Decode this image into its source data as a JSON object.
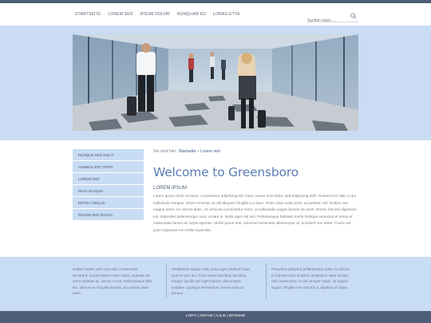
{
  "nav": {
    "items": [
      "Startseite",
      "Lorem sed",
      "Ipsum dolor",
      "Nunquam ed",
      "Lorag etta"
    ]
  },
  "search": {
    "placeholder": "Suchen nach ..."
  },
  "sidebar": {
    "items": [
      "Nunque sed dolit",
      "Hambus est oppo",
      "Lorem sed",
      "Nullus iquis",
      "Entra vibilus",
      "Nolem sed dolda"
    ]
  },
  "main": {
    "breadcrumb_prefix": "Sie sind hier:",
    "breadcrumb_home": "Startseite",
    "breadcrumb_sep": "»",
    "breadcrumb_current": "Lorem sed",
    "title": "Welcome to Greensboro",
    "subtitle": "Lorem ipsum",
    "paragraph": "Lorem ipsum dolor sit amet, consectetur adipiscing elit. Nunc varius eros dolor, sed adipiscing nibh. Praesent id nibh ut dui sollicitudin tempus. Etiam et lectus ac elit aliquam fringilla a a diam. Proin vitae nulla tortor, at porttitor nisl. Nullam nec magna tortor, eu viverra diam. Ut vehicula consectetur tortor, ut sollicitudin augue laoreet sit amet. Donec lobortis dignissim est, imperdiet pellentesque nunc ornare in. Nulla eget nisl nisl. Pellentesque habitant morbi tristique senectus et netus et malesuada fames ac turpis egestas. Morbi purus erat, euismod venenatis ullamcorper at, tincidunt non tellus. Fusce vel justo vulputate est mollis imperdiet."
  },
  "footer": {
    "columns": [
      "Nullam mattis ante non odio consectetur hendrerit. Suspendisse lorem dolor, molestie sit amet sodales ac, auctor et elit. Pellentesque felis leo, ultrices eu fringilla laoreet, accumsan vitae enim",
      "Vestibulum neque velit, porta eget eleifend vitae, viverra quis leo. Cras varius faucibus faucibus. Integer iaculis nisl eget mauris ullamcorper sodales. Quisque elementum viverra ante ac tempor.",
      "Phasellus pharetra pellentesque nulla eu dictum. In lobortis urna id tellus vestibulum vitae lacinia nisl consectetur. In vel semper turpis. Ut sapien augue, fringilla non lobortis a, dapibus id turpis."
    ]
  },
  "bottom_links": {
    "items": [
      "Lopo",
      "Ontok",
      "Iulik",
      "Epsond"
    ],
    "separator": "|"
  },
  "colors": {
    "top_bar": "#4f5e78",
    "band": "#c8dcf4",
    "title_blue": "#5c7db5"
  }
}
